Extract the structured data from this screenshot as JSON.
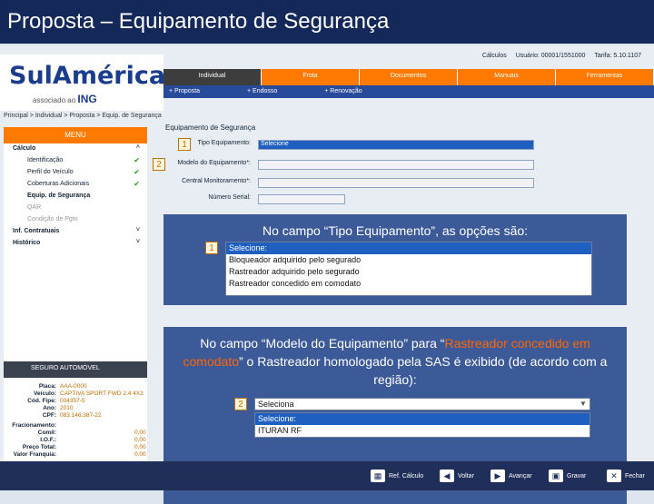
{
  "slide": {
    "title": "Proposta – Equipamento de Segurança"
  },
  "topbar": {
    "calculos": "Cálculos",
    "usuario": "Usuário: 00001/1551000",
    "tarifa": "Tarifa: 5.10.1107"
  },
  "logo": {
    "brand": "SulAmérica",
    "associado": "associado ao",
    "ing": "ING"
  },
  "nav": [
    "Individual",
    "Frota",
    "Documentos",
    "Manuais",
    "Ferramentas"
  ],
  "subnav": [
    "+ Proposta",
    "+ Endosso",
    "+ Renovação"
  ],
  "breadcrumb": "Principal > Individual > Proposta > Equip. de Segurança",
  "sidebar": {
    "menu_label": "MENU",
    "calculo": "Cálculo",
    "items": [
      "Identificação",
      "Perfil do Veículo",
      "Coberturas Adicionais"
    ],
    "current": "Equip. de Segurança",
    "disabled": [
      "QAR",
      "Condição de Pgto"
    ],
    "inf_contratuais": "Inf. Contratuais",
    "historico": "Histórico",
    "seguro_label": "SEGURO AUTOMÓVEL",
    "info": [
      {
        "k": "Placa:",
        "v": "AAA-0000"
      },
      {
        "k": "Veículo:",
        "v": "CAPTIVA SPORT FWD 2.4 4X2"
      },
      {
        "k": "Cód. Fipe:",
        "v": "004357-5"
      },
      {
        "k": "Ano:",
        "v": "2010"
      },
      {
        "k": "CPF:",
        "v": "083.146.387-22"
      }
    ],
    "fracionamento_label": "Fracionamento:",
    "totals": [
      {
        "k": "Comil:",
        "v": "0,00"
      },
      {
        "k": "I.O.F.:",
        "v": "0,00"
      },
      {
        "k": "Preço Total:",
        "v": "0,00"
      },
      {
        "k": "Valor Franquia:",
        "v": "0,00"
      }
    ]
  },
  "form": {
    "title": "Equipamento de Segurança",
    "tipo_label": "Tipo Equipamento:",
    "tipo_value": "Selecione",
    "modelo_label": "Modelo do Equipamento*:",
    "central_label": "Central Monitoramento*:",
    "numero_label": "Número Serial:"
  },
  "callout1": {
    "badge": "1",
    "text": "No campo “Tipo Equipamento”, as opções são:",
    "options": [
      "Selecione:",
      "Bloqueador adquirido pelo segurado",
      "Rastreador adquirido pelo segurado",
      "Rastreador concedido em comodato"
    ]
  },
  "callout2": {
    "badge": "2",
    "text_a": "No campo “Modelo do Equipamento” para “",
    "text_hl": "Rastreador concedido em comodato",
    "text_b": "” o Rastreador homologado pela SAS é exibido (de acordo com a região):",
    "dropdown_value": "Seleciona",
    "options": [
      "Selecione:",
      "ITURAN RF"
    ]
  },
  "bottom": [
    "Ref. Cálculo",
    "Voltar",
    "Avançar",
    "Gravar",
    "Fechar"
  ]
}
